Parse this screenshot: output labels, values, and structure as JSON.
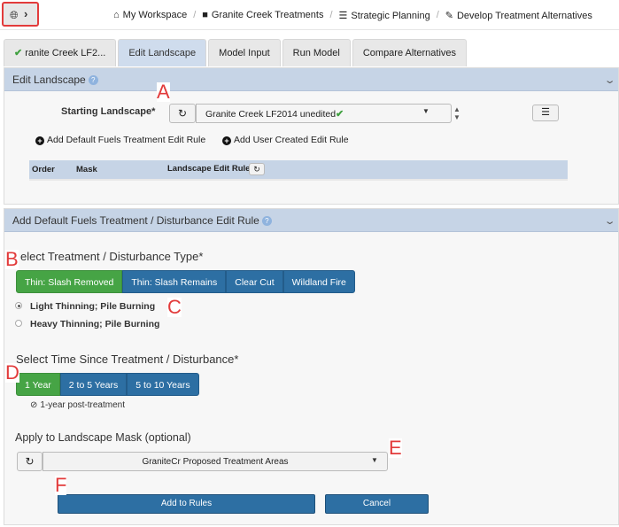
{
  "breadcrumb": {
    "items": [
      {
        "icon": "home-icon",
        "glyph": "⌂",
        "label": "My Workspace"
      },
      {
        "icon": "folder-icon",
        "glyph": "■",
        "label": "Granite Creek Treatments"
      },
      {
        "icon": "list-icon",
        "glyph": "☰",
        "label": "Strategic Planning"
      },
      {
        "icon": "pencil-icon",
        "glyph": "✎",
        "label": "Develop Treatment Alternatives"
      }
    ]
  },
  "tabs": [
    {
      "label": "ranite Creek LF2...",
      "checked": true
    },
    {
      "label": "Edit Landscape",
      "active": true
    },
    {
      "label": "Model Input"
    },
    {
      "label": "Run Model"
    },
    {
      "label": "Compare Alternatives"
    }
  ],
  "edit_landscape": {
    "title": "Edit Landscape",
    "starting_label": "Starting Landscape*",
    "starting_value": "Granite Creek LF2014 unedited",
    "add_default_rule": "Add Default Fuels Treatment Edit Rule",
    "add_user_rule": "Add User Created Edit Rule",
    "table_headers": [
      "Order",
      "Mask",
      "Landscape Edit Rule"
    ]
  },
  "add_rule": {
    "title": "Add Default Fuels Treatment / Disturbance Edit Rule",
    "type_label": "elect Treatment / Disturbance Type*",
    "type_options": [
      "Thin: Slash Removed",
      "Thin: Slash Remains",
      "Clear Cut",
      "Wildland Fire"
    ],
    "type_selected": 0,
    "sub_options": [
      "Light Thinning; Pile Burning",
      "Heavy Thinning; Pile Burning"
    ],
    "sub_selected": 0,
    "time_label": "Select Time Since Treatment / Disturbance*",
    "time_options": [
      "1 Year",
      "2 to 5 Years",
      "5 to 10 Years"
    ],
    "time_selected": 0,
    "time_note": "1-year post-treatment",
    "mask_label": "Apply to Landscape Mask (optional)",
    "mask_value": "GraniteCr Proposed Treatment Areas",
    "add_button": "Add to Rules",
    "cancel_button": "Cancel"
  },
  "annotations": [
    "A",
    "B",
    "C",
    "D",
    "E",
    "F"
  ],
  "colors": {
    "accent_blue": "#2d6fa3",
    "selected_green": "#46a445",
    "panel_header": "#c6d4e6",
    "annotation_red": "#e23b3b"
  }
}
